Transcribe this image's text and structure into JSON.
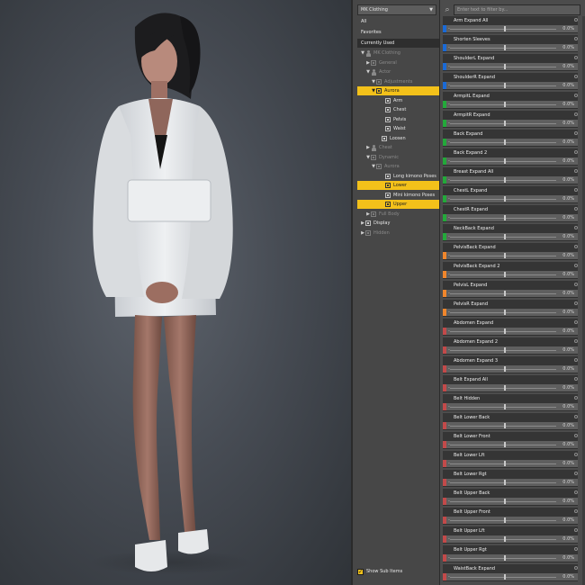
{
  "preview": {
    "caption": ""
  },
  "tree": {
    "preset": "MK Clothing",
    "dropdown_arrow": "▼",
    "top_items": [
      {
        "label": "All"
      },
      {
        "label": "Favorites"
      },
      {
        "label": "Currently Used"
      }
    ],
    "nodes": [
      {
        "label": "MK Clothing",
        "tri": "▼",
        "icon": "person",
        "dim": true
      },
      {
        "label": "General",
        "tri": "▶",
        "icon": "box",
        "dim": true
      },
      {
        "label": "Actor",
        "tri": "▼",
        "icon": "person",
        "dim": true
      },
      {
        "label": "Adjustments",
        "tri": "▼",
        "icon": "box",
        "dim": true
      },
      {
        "label": "Aurora",
        "tri": "▼",
        "icon": "box",
        "dim": false,
        "highlight": true
      },
      {
        "label": "Arm",
        "tri": "",
        "icon": "box",
        "dim": false
      },
      {
        "label": "Chest",
        "tri": "",
        "icon": "box",
        "dim": false
      },
      {
        "label": "Pelvis",
        "tri": "",
        "icon": "box",
        "dim": false
      },
      {
        "label": "Waist",
        "tri": "",
        "icon": "box",
        "dim": false
      },
      {
        "label": "Loosen",
        "tri": "",
        "icon": "box",
        "dim": false
      },
      {
        "label": "Cheat",
        "tri": "▶",
        "icon": "person",
        "dim": true
      },
      {
        "label": "Dynamic",
        "tri": "▼",
        "icon": "box",
        "dim": true
      },
      {
        "label": "Aurora",
        "tri": "▼",
        "icon": "box",
        "dim": true
      },
      {
        "label": "Long kimono Poses",
        "tri": "",
        "icon": "box",
        "dim": false
      },
      {
        "label": "Lower",
        "tri": "",
        "icon": "box",
        "dim": false,
        "highlight": true
      },
      {
        "label": "Mini kimono Poses",
        "tri": "",
        "icon": "box",
        "dim": false
      },
      {
        "label": "Upper",
        "tri": "",
        "icon": "box",
        "dim": false,
        "highlight": true
      },
      {
        "label": "Full Body",
        "tri": "▶",
        "icon": "box",
        "dim": true
      },
      {
        "label": "Display",
        "tri": "▶",
        "icon": "box",
        "dim": false
      },
      {
        "label": "Hidden",
        "tri": "▶",
        "icon": "box",
        "dim": true
      }
    ],
    "show_sub_items": "Show Sub Items",
    "show_sub_checked": "✓"
  },
  "search": {
    "placeholder": "Enter text to filter by..."
  },
  "colors": {
    "highlight": "#f3c11a",
    "blue": "#1a6ad6",
    "green": "#23a93a",
    "orange": "#f0862c",
    "red": "#c24a4a",
    "panel_bg": "#4a4a4a"
  },
  "sliders": [
    {
      "label": "Arm Expand All",
      "value": "0.0%",
      "color": "blue"
    },
    {
      "label": "Shorten Sleeves",
      "value": "0.0%",
      "color": "blue"
    },
    {
      "label": "ShoulderL Expand",
      "value": "0.0%",
      "color": "blue"
    },
    {
      "label": "ShoulderR Expand",
      "value": "0.0%",
      "color": "blue"
    },
    {
      "label": "ArmpitL Expand",
      "value": "0.0%",
      "color": "green"
    },
    {
      "label": "ArmpitR Expand",
      "value": "0.0%",
      "color": "green"
    },
    {
      "label": "Back Expand",
      "value": "0.0%",
      "color": "green"
    },
    {
      "label": "Back Expand 2",
      "value": "0.0%",
      "color": "green"
    },
    {
      "label": "Breast Expand All",
      "value": "0.0%",
      "color": "green"
    },
    {
      "label": "ChestL Expand",
      "value": "0.0%",
      "color": "green"
    },
    {
      "label": "ChestR Expand",
      "value": "0.0%",
      "color": "green"
    },
    {
      "label": "NeckBack Expand",
      "value": "0.0%",
      "color": "green"
    },
    {
      "label": "PelvisBack Expand",
      "value": "0.0%",
      "color": "orange"
    },
    {
      "label": "PelvisBack Expand 2",
      "value": "0.0%",
      "color": "orange"
    },
    {
      "label": "PelvisL Expand",
      "value": "0.0%",
      "color": "orange"
    },
    {
      "label": "PelvisR Expand",
      "value": "0.0%",
      "color": "orange"
    },
    {
      "label": "Abdomen Expand",
      "value": "0.0%",
      "color": "red"
    },
    {
      "label": "Abdomen Expand 2",
      "value": "0.0%",
      "color": "red"
    },
    {
      "label": "Abdomen Expand 3",
      "value": "0.0%",
      "color": "red"
    },
    {
      "label": "Belt Expand All",
      "value": "0.0%",
      "color": "red"
    },
    {
      "label": "Belt Hidden",
      "value": "0.0%",
      "color": "red"
    },
    {
      "label": "Belt Lower Back",
      "value": "0.0%",
      "color": "red"
    },
    {
      "label": "Belt Lower Front",
      "value": "0.0%",
      "color": "red"
    },
    {
      "label": "Belt Lower Lft",
      "value": "0.0%",
      "color": "red"
    },
    {
      "label": "Belt Lower Rgt",
      "value": "0.0%",
      "color": "red"
    },
    {
      "label": "Belt Upper Back",
      "value": "0.0%",
      "color": "red"
    },
    {
      "label": "Belt Upper Front",
      "value": "0.0%",
      "color": "red"
    },
    {
      "label": "Belt Upper Lft",
      "value": "0.0%",
      "color": "red"
    },
    {
      "label": "Belt Upper Rgt",
      "value": "0.0%",
      "color": "red"
    },
    {
      "label": "WaistBack Expand",
      "value": "0.0%",
      "color": "red"
    }
  ]
}
